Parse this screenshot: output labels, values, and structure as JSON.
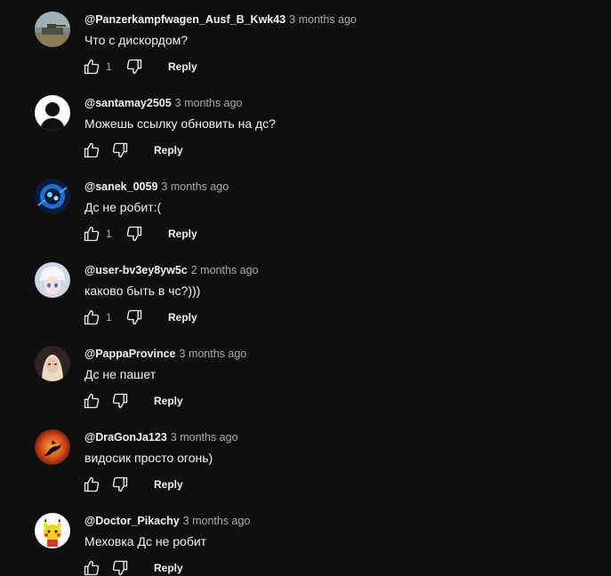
{
  "comments": [
    {
      "author": "@Panzerkampfwagen_Ausf_B_Kwk43",
      "time": "3 months ago",
      "text": "Что с дискордом?",
      "likes": "1",
      "avatar": "tank-avatar-icon"
    },
    {
      "author": "@santamay2505",
      "time": "3 months ago",
      "text": "Можешь ссылку обновить на дс?",
      "likes": "",
      "avatar": "silhouette-avatar-icon"
    },
    {
      "author": "@sanek_0059",
      "time": "3 months ago",
      "text": "Дс не робит:(",
      "likes": "1",
      "avatar": "blue-logo-avatar-icon"
    },
    {
      "author": "@user-bv3ey8yw5c",
      "time": "2 months ago",
      "text": "каково быть в чс?)))",
      "likes": "1",
      "avatar": "anime-boy-avatar-icon"
    },
    {
      "author": "@PappaProvince",
      "time": "3 months ago",
      "text": "Дс не пашет",
      "likes": "",
      "avatar": "portrait-avatar-icon"
    },
    {
      "author": "@DraGonJa123",
      "time": "3 months ago",
      "text": "видосик просто огонь)",
      "likes": "",
      "avatar": "dragon-avatar-icon"
    },
    {
      "author": "@Doctor_Pikachy",
      "time": "3 months ago",
      "text": "Меховка Дс не робит",
      "likes": "",
      "avatar": "pikachu-avatar-icon"
    }
  ],
  "reply_label": "Reply",
  "colors": {
    "background": "#0f0f0f",
    "text_primary": "#f1f1f1",
    "text_secondary": "#aaaaaa"
  }
}
